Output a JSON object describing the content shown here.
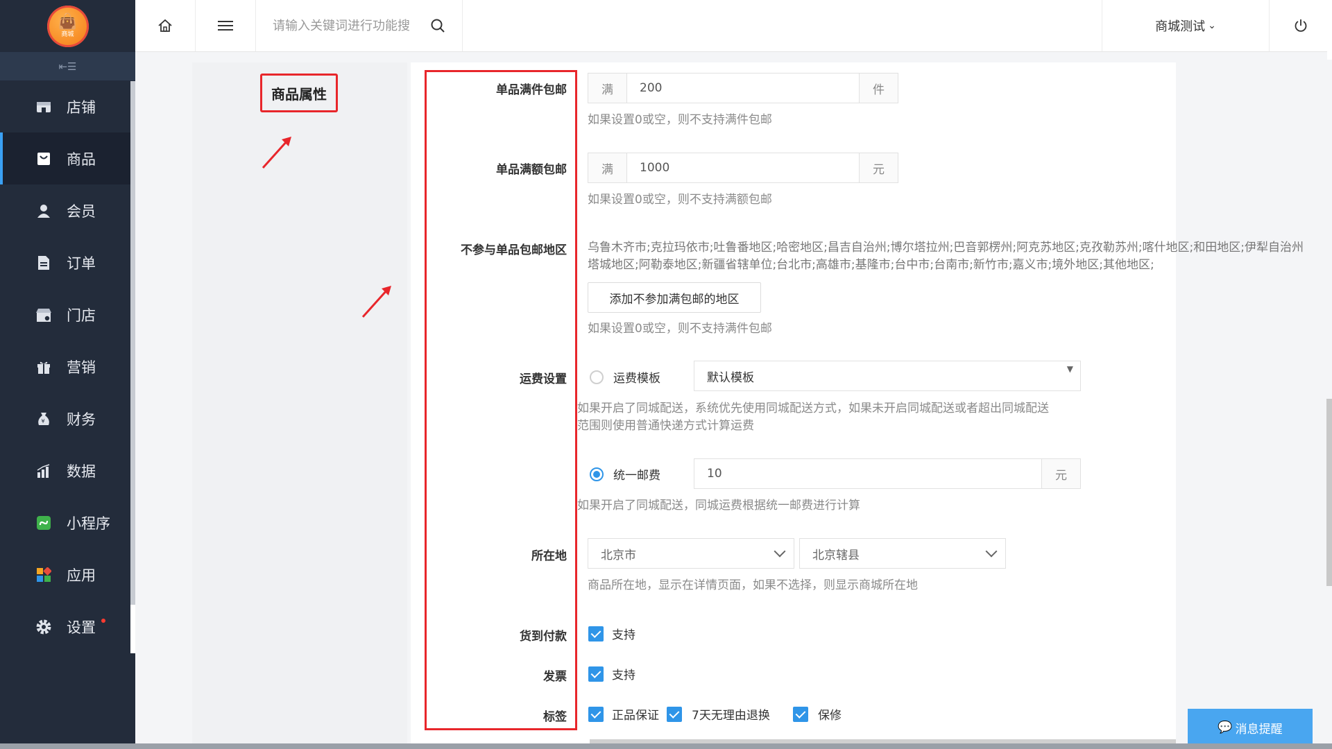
{
  "brand": {
    "logo_text": "商城"
  },
  "sidebar": {
    "items": [
      {
        "label": "店铺",
        "icon": "store-icon",
        "active": false
      },
      {
        "label": "商品",
        "icon": "shopping-bag-icon",
        "active": true
      },
      {
        "label": "会员",
        "icon": "user-icon",
        "active": false
      },
      {
        "label": "订单",
        "icon": "document-icon",
        "active": false
      },
      {
        "label": "门店",
        "icon": "shop-front-icon",
        "active": false
      },
      {
        "label": "营销",
        "icon": "gift-icon",
        "active": false
      },
      {
        "label": "财务",
        "icon": "money-bag-icon",
        "active": false
      },
      {
        "label": "数据",
        "icon": "bar-chart-icon",
        "active": false
      },
      {
        "label": "小程序",
        "icon": "mini-program-icon",
        "active": false
      },
      {
        "label": "应用",
        "icon": "apps-grid-icon",
        "active": false
      },
      {
        "label": "设置",
        "icon": "gear-icon",
        "active": false,
        "badge": true
      }
    ]
  },
  "topbar": {
    "search_placeholder": "请输入关键词进行功能搜",
    "shop_name": "商城测试",
    "shop_caret": "⌄"
  },
  "section": {
    "title": "商品属性"
  },
  "form": {
    "free_ship_count": {
      "label": "单品满件包邮",
      "prefix": "满",
      "value": "200",
      "suffix": "件",
      "hint": "如果设置0或空，则不支持满件包邮"
    },
    "free_ship_amount": {
      "label": "单品满额包邮",
      "prefix": "满",
      "value": "1000",
      "suffix": "元",
      "hint": "如果设置0或空，则不支持满额包邮"
    },
    "excluded_regions": {
      "label": "不参与单品包邮地区",
      "line1": "乌鲁木齐市;克拉玛依市;吐鲁番地区;哈密地区;昌吉自治州;博尔塔拉州;巴音郭楞州;阿克苏地区;克孜勒苏州;喀什地区;和田地区;伊犁自治州",
      "line2": "塔城地区;阿勒泰地区;新疆省辖单位;台北市;高雄市;基隆市;台中市;台南市;新竹市;嘉义市;境外地区;其他地区;",
      "button": "添加不参加满包邮的地区",
      "hint": "如果设置0或空，则不支持满件包邮"
    },
    "shipping": {
      "label": "运费设置",
      "template_option": "运费模板",
      "template_value": "默认模板",
      "template_hint1": "如果开启了同城配送，系统优先使用同城配送方式，如果未开启同城配送或者超出同城配送",
      "template_hint2": "范围则使用普通快递方式计算运费",
      "flat_option": "统一邮费",
      "flat_value": "10",
      "flat_suffix": "元",
      "flat_hint": "如果开启了同城配送，同城运费根据统一邮费进行计算"
    },
    "location": {
      "label": "所在地",
      "province": "北京市",
      "district": "北京辖县",
      "hint": "商品所在地，显示在详情页面，如果不选择，则显示商城所在地"
    },
    "cod": {
      "label": "货到付款",
      "option": "支持"
    },
    "invoice": {
      "label": "发票",
      "option": "支持"
    },
    "tags": {
      "label": "标签",
      "options": [
        "正品保证",
        "7天无理由退换",
        "保修"
      ]
    }
  },
  "message_button": "消息提醒",
  "colors": {
    "sidebar_bg": "#232c3b",
    "accent": "#2f95e8",
    "annotation_red": "#e8262b"
  }
}
